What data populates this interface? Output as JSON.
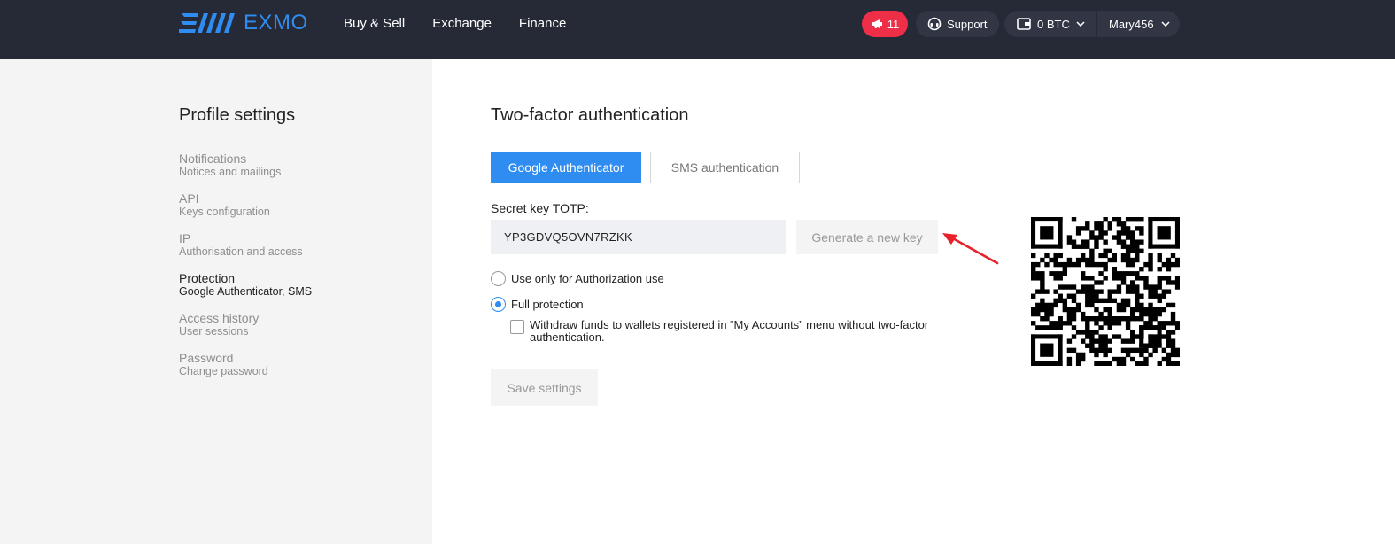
{
  "header": {
    "brand": "EXMO",
    "nav": [
      "Buy & Sell",
      "Exchange",
      "Finance"
    ],
    "notifications_count": "11",
    "support_label": "Support",
    "balance_label": "0 BTC",
    "username": "Mary456"
  },
  "sidebar": {
    "title": "Profile settings",
    "items": [
      {
        "title": "Notifications",
        "subtitle": "Notices and mailings",
        "active": false
      },
      {
        "title": "API",
        "subtitle": "Keys configuration",
        "active": false
      },
      {
        "title": "IP",
        "subtitle": "Authorisation and access",
        "active": false
      },
      {
        "title": "Protection",
        "subtitle": "Google Authenticator, SMS",
        "active": true
      },
      {
        "title": "Access history",
        "subtitle": "User sessions",
        "active": false
      },
      {
        "title": "Password",
        "subtitle": "Change password",
        "active": false
      }
    ]
  },
  "main": {
    "title": "Two-factor authentication",
    "tabs": {
      "google": "Google Authenticator",
      "sms": "SMS authentication",
      "active": "google"
    },
    "secret_label": "Secret key TOTP:",
    "secret_value": "YP3GDVQ5OVN7RZKK",
    "generate_label": "Generate a new key",
    "option_auth_only": "Use only for Authorization use",
    "option_full": "Full protection",
    "selected_option": "full",
    "withdraw_checkbox": "Withdraw funds to wallets registered in “My Accounts” menu without two-factor authentication.",
    "withdraw_checked": false,
    "save_label": "Save settings"
  },
  "colors": {
    "header_bg": "#262a37",
    "accent": "#2f8cf0",
    "badge": "#ef2e48",
    "annotation_arrow": "#e8202a"
  }
}
